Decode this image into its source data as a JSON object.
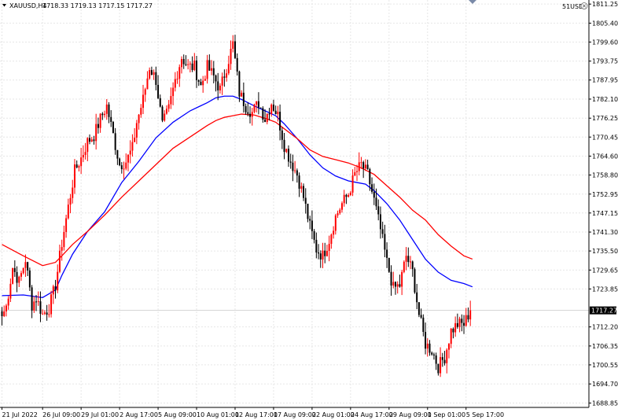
{
  "header": {
    "symbol": "XAUUSD,H4",
    "ohlc": "1718.33 1719.13 1717.15 1717.27",
    "badge": "51USD",
    "close_icon": "close-circle-icon"
  },
  "colors": {
    "bg": "#ffffff",
    "grid": "#e6e6e6",
    "bull": "#ff0000",
    "bear": "#000000",
    "ma_fast": "#0000ff",
    "ma_slow": "#ff0000",
    "axis": "#000000",
    "last_price_bg": "#000000",
    "last_price_fg": "#ffffff"
  },
  "chart_data": {
    "type": "candlestick",
    "title": "",
    "xlabel": "",
    "ylabel": "",
    "y_ticks": [
      1811.25,
      1805.4,
      1799.6,
      1793.75,
      1787.95,
      1782.1,
      1776.25,
      1770.45,
      1764.6,
      1758.8,
      1752.95,
      1747.15,
      1741.3,
      1735.5,
      1729.65,
      1723.85,
      1717.27,
      1712.2,
      1706.35,
      1700.55,
      1694.7,
      1688.85
    ],
    "last_price": 1717.27,
    "ylim": [
      1687.5,
      1812.5
    ],
    "x_ticks": [
      {
        "i": 0,
        "label": "21 Jul 2022"
      },
      {
        "i": 19,
        "label": "26 Jul 09:00"
      },
      {
        "i": 37,
        "label": "29 Jul 01:00"
      },
      {
        "i": 55,
        "label": "2 Aug 17:00"
      },
      {
        "i": 73,
        "label": "5 Aug 09:00"
      },
      {
        "i": 91,
        "label": "10 Aug 01:00"
      },
      {
        "i": 109,
        "label": "12 Aug 17:00"
      },
      {
        "i": 127,
        "label": "17 Aug 09:00"
      },
      {
        "i": 145,
        "label": "22 Aug 01:00"
      },
      {
        "i": 163,
        "label": "24 Aug 17:00"
      },
      {
        "i": 181,
        "label": "29 Aug 09:00"
      },
      {
        "i": 199,
        "label": "1 Sep 01:00"
      },
      {
        "i": 217,
        "label": "5 Sep 17:00"
      }
    ],
    "anchors": [
      [
        0,
        1715.5
      ],
      [
        2,
        1718.5
      ],
      [
        5,
        1730.5
      ],
      [
        8,
        1726.0
      ],
      [
        11,
        1733.0
      ],
      [
        14,
        1719.0
      ],
      [
        16,
        1721.0
      ],
      [
        19,
        1716.0
      ],
      [
        22,
        1718.0
      ],
      [
        25,
        1725.0
      ],
      [
        28,
        1738.0
      ],
      [
        31,
        1749.0
      ],
      [
        34,
        1760.0
      ],
      [
        37,
        1764.0
      ],
      [
        40,
        1769.0
      ],
      [
        43,
        1771.0
      ],
      [
        46,
        1776.0
      ],
      [
        49,
        1780.0
      ],
      [
        52,
        1771.0
      ],
      [
        55,
        1762.0
      ],
      [
        58,
        1763.0
      ],
      [
        61,
        1767.0
      ],
      [
        63,
        1775.0
      ],
      [
        66,
        1782.0
      ],
      [
        69,
        1792.0
      ],
      [
        72,
        1788.0
      ],
      [
        75,
        1774.0
      ],
      [
        78,
        1779.0
      ],
      [
        81,
        1788.0
      ],
      [
        84,
        1795.0
      ],
      [
        87,
        1792.0
      ],
      [
        90,
        1792.0
      ],
      [
        93,
        1786.0
      ],
      [
        96,
        1792.0
      ],
      [
        99,
        1789.0
      ],
      [
        102,
        1785.0
      ],
      [
        105,
        1792.0
      ],
      [
        108,
        1799.0
      ],
      [
        111,
        1784.0
      ],
      [
        114,
        1780.0
      ],
      [
        117,
        1778.0
      ],
      [
        120,
        1781.0
      ],
      [
        123,
        1776.0
      ],
      [
        126,
        1781.0
      ],
      [
        129,
        1777.0
      ],
      [
        132,
        1768.0
      ],
      [
        135,
        1763.0
      ],
      [
        138,
        1759.0
      ],
      [
        141,
        1752.0
      ],
      [
        144,
        1743.0
      ],
      [
        147,
        1736.0
      ],
      [
        150,
        1734.0
      ],
      [
        153,
        1739.0
      ],
      [
        156,
        1746.0
      ],
      [
        159,
        1750.0
      ],
      [
        162,
        1753.0
      ],
      [
        165,
        1759.0
      ],
      [
        168,
        1762.0
      ],
      [
        171,
        1759.0
      ],
      [
        174,
        1751.0
      ],
      [
        177,
        1742.0
      ],
      [
        180,
        1732.0
      ],
      [
        183,
        1724.0
      ],
      [
        186,
        1725.0
      ],
      [
        189,
        1734.0
      ],
      [
        192,
        1729.0
      ],
      [
        195,
        1716.0
      ],
      [
        198,
        1707.0
      ],
      [
        201,
        1705.0
      ],
      [
        204,
        1700.0
      ],
      [
        207,
        1703.0
      ],
      [
        210,
        1711.0
      ],
      [
        213,
        1713.0
      ],
      [
        216,
        1713.0
      ],
      [
        219,
        1717.27
      ]
    ],
    "series": [
      {
        "name": "",
        "kind": "ma",
        "color": "#0000ff",
        "x": [
          0,
          10,
          19,
          25,
          28,
          33,
          40,
          48,
          56,
          64,
          72,
          80,
          88,
          96,
          100,
          104,
          108,
          112,
          118,
          124,
          128,
          132,
          138,
          144,
          150,
          156,
          162,
          166,
          170,
          174,
          180,
          186,
          192,
          198,
          204,
          210,
          216,
          220
        ],
        "y": [
          1721.8,
          1722.0,
          1721.2,
          1723.5,
          1728.0,
          1734.5,
          1741.5,
          1747.5,
          1756.5,
          1763.0,
          1770.2,
          1775.0,
          1778.5,
          1781.0,
          1782.5,
          1783.0,
          1783.0,
          1782.0,
          1780.0,
          1778.2,
          1777.0,
          1774.5,
          1770.0,
          1765.0,
          1761.0,
          1758.5,
          1757.0,
          1756.5,
          1756.0,
          1754.0,
          1750.0,
          1745.0,
          1739.0,
          1733.0,
          1729.0,
          1726.5,
          1725.5,
          1724.5
        ]
      },
      {
        "name": "",
        "kind": "ma",
        "color": "#ff0000",
        "x": [
          0,
          10,
          19,
          25,
          28,
          33,
          40,
          48,
          56,
          64,
          72,
          80,
          88,
          96,
          100,
          104,
          108,
          112,
          118,
          124,
          128,
          132,
          138,
          144,
          150,
          156,
          162,
          168,
          174,
          180,
          186,
          192,
          198,
          204,
          210,
          216,
          220
        ],
        "y": [
          1737.5,
          1734.0,
          1731.0,
          1732.0,
          1734.0,
          1737.5,
          1741.5,
          1746.5,
          1752.0,
          1757.0,
          1762.0,
          1767.0,
          1770.5,
          1774.0,
          1775.5,
          1776.5,
          1777.0,
          1777.5,
          1777.2,
          1776.0,
          1775.0,
          1773.0,
          1770.0,
          1766.5,
          1764.5,
          1763.5,
          1762.5,
          1761.0,
          1759.0,
          1755.5,
          1752.0,
          1748.0,
          1745.0,
          1740.5,
          1737.0,
          1734.0,
          1733.0
        ]
      }
    ],
    "ohlc_series": "generated-from-anchors",
    "n_bars": 220
  }
}
